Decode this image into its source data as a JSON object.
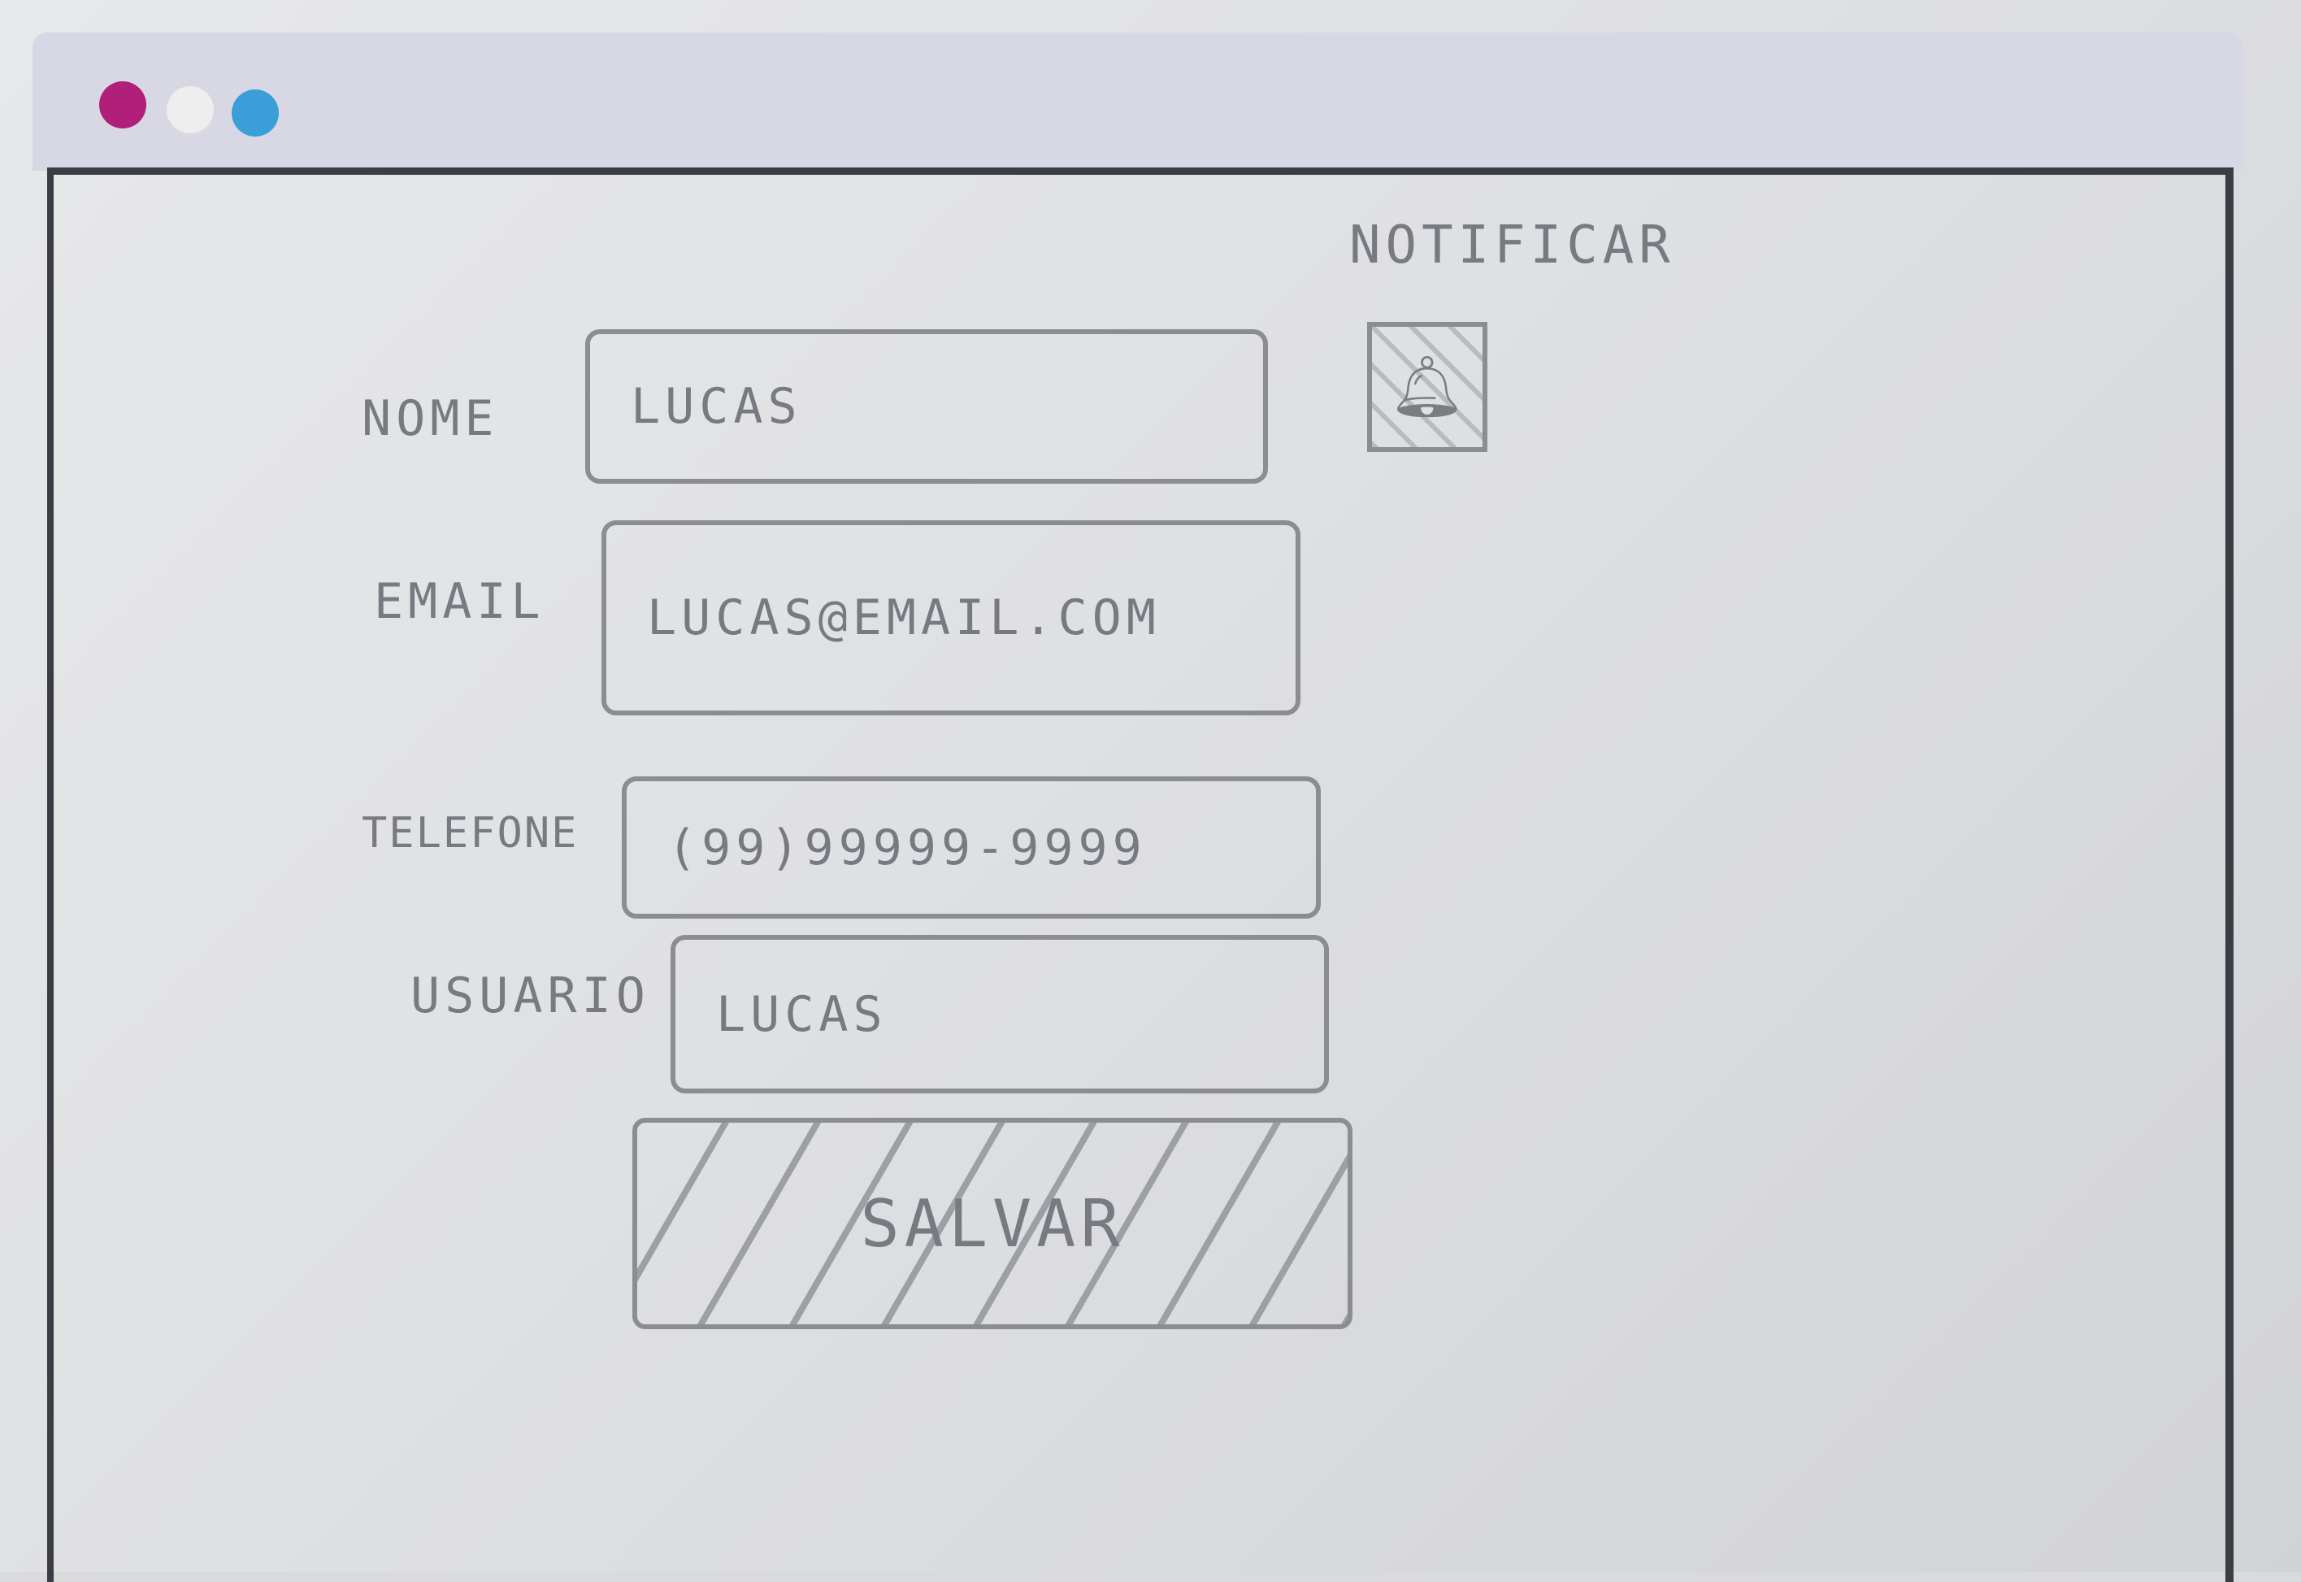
{
  "form": {
    "fields": [
      {
        "label": "NOME",
        "value": "LUCAS"
      },
      {
        "label": "EMAIL",
        "value": "LUCAS@EMAIL.COM"
      },
      {
        "label": "TELEFONE",
        "value": "(99)99999-9999"
      },
      {
        "label": "USUARIO",
        "value": "LUCAS"
      }
    ],
    "save_label": "SALVAR"
  },
  "notify": {
    "label": "NOTIFICAR",
    "checked": true
  },
  "window_controls": {
    "close_color": "#b01f7a",
    "minimize_color": "#eeeeee",
    "maximize_color": "#3a9fd8"
  }
}
